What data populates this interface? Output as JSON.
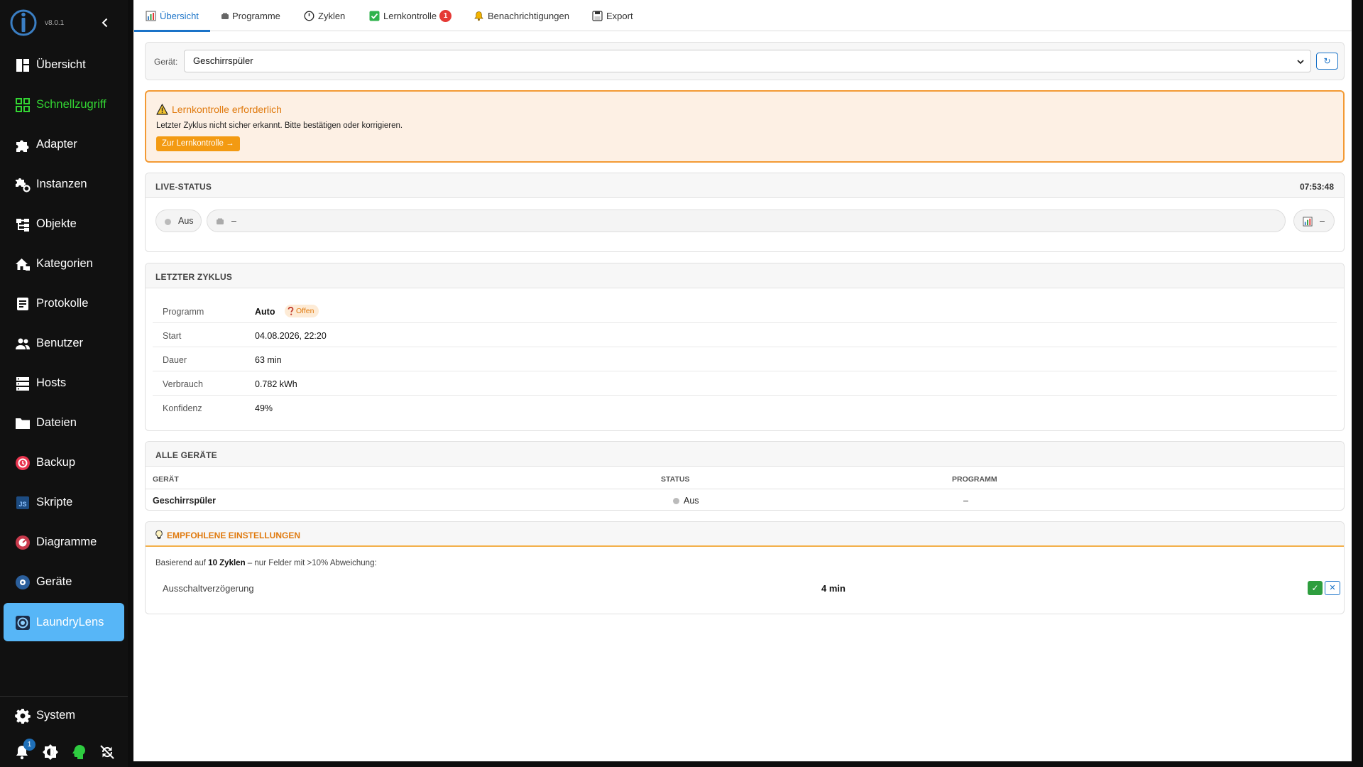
{
  "app": {
    "version": "v8.0.1"
  },
  "sidebar": {
    "items": [
      {
        "label": "Übersicht",
        "icon": "dashboard-icon"
      },
      {
        "label": "Schnellzugriff",
        "icon": "grid-icon"
      },
      {
        "label": "Adapter",
        "icon": "puzzle-icon"
      },
      {
        "label": "Instanzen",
        "icon": "puzzle-gear-icon"
      },
      {
        "label": "Objekte",
        "icon": "tree-icon"
      },
      {
        "label": "Kategorien",
        "icon": "home-category-icon"
      },
      {
        "label": "Protokolle",
        "icon": "log-icon"
      },
      {
        "label": "Benutzer",
        "icon": "users-icon"
      },
      {
        "label": "Hosts",
        "icon": "server-icon"
      },
      {
        "label": "Dateien",
        "icon": "folder-icon"
      },
      {
        "label": "Backup",
        "icon": "backup-icon"
      },
      {
        "label": "Skripte",
        "icon": "javascript-icon"
      },
      {
        "label": "Diagramme",
        "icon": "chart-icon"
      },
      {
        "label": "Geräte",
        "icon": "devices-icon"
      },
      {
        "label": "LaundryLens",
        "icon": "laundrylens-icon"
      }
    ],
    "system_label": "System",
    "notification_count": "1"
  },
  "tabs": [
    {
      "label": "Übersicht",
      "icon": "chart-icon"
    },
    {
      "label": "Programme",
      "icon": "program-icon"
    },
    {
      "label": "Zyklen",
      "icon": "clock-icon"
    },
    {
      "label": "Lernkontrolle",
      "icon": "check-icon",
      "badge": "1"
    },
    {
      "label": "Benachrichtigungen",
      "icon": "bell-icon"
    },
    {
      "label": "Export",
      "icon": "export-icon"
    }
  ],
  "device_select": {
    "label": "Gerät:",
    "value": "Geschirrspüler",
    "refresh": "↻"
  },
  "alert": {
    "title": "Lernkontrolle erforderlich",
    "text": "Letzter Zyklus nicht sicher erkannt. Bitte bestätigen oder korrigieren.",
    "button": "Zur Lernkontrolle →"
  },
  "live_status": {
    "title": "LIVE-STATUS",
    "time": "07:53:48",
    "state": "Aus",
    "program": "–",
    "power": "–"
  },
  "last_cycle": {
    "title": "LETZTER ZYKLUS",
    "rows": [
      {
        "key": "Programm",
        "value": "Auto",
        "badge": "Offen"
      },
      {
        "key": "Start",
        "value": "04.08.2026, 22:20"
      },
      {
        "key": "Dauer",
        "value": "63 min"
      },
      {
        "key": "Verbrauch",
        "value": "0.782 kWh"
      },
      {
        "key": "Konfidenz",
        "value": "49%"
      }
    ]
  },
  "all_devices": {
    "title": "ALLE GERÄTE",
    "columns": [
      "GERÄT",
      "STATUS",
      "PROGRAMM"
    ],
    "rows": [
      {
        "device": "Geschirrspüler",
        "status": "Aus",
        "program": "–"
      }
    ]
  },
  "recommended": {
    "title": "EMPFOHLENE EINSTELLUNGEN",
    "text_prefix": "Basierend auf",
    "text_bold": "10 Zyklen",
    "text_suffix": "– nur Felder mit >10% Abweichung:",
    "field": "Ausschaltverzögerung",
    "value": "4 min",
    "accept": "✓",
    "reject": "✕"
  },
  "colors": {
    "accent": "#1a73c8",
    "sidebar_bg": "#111111",
    "active_nav": "#57b6f7",
    "quick_access": "#33d633",
    "alert_border": "#f39a34",
    "alert_bg": "#fdf0e4",
    "accept": "#2e9e3e"
  }
}
